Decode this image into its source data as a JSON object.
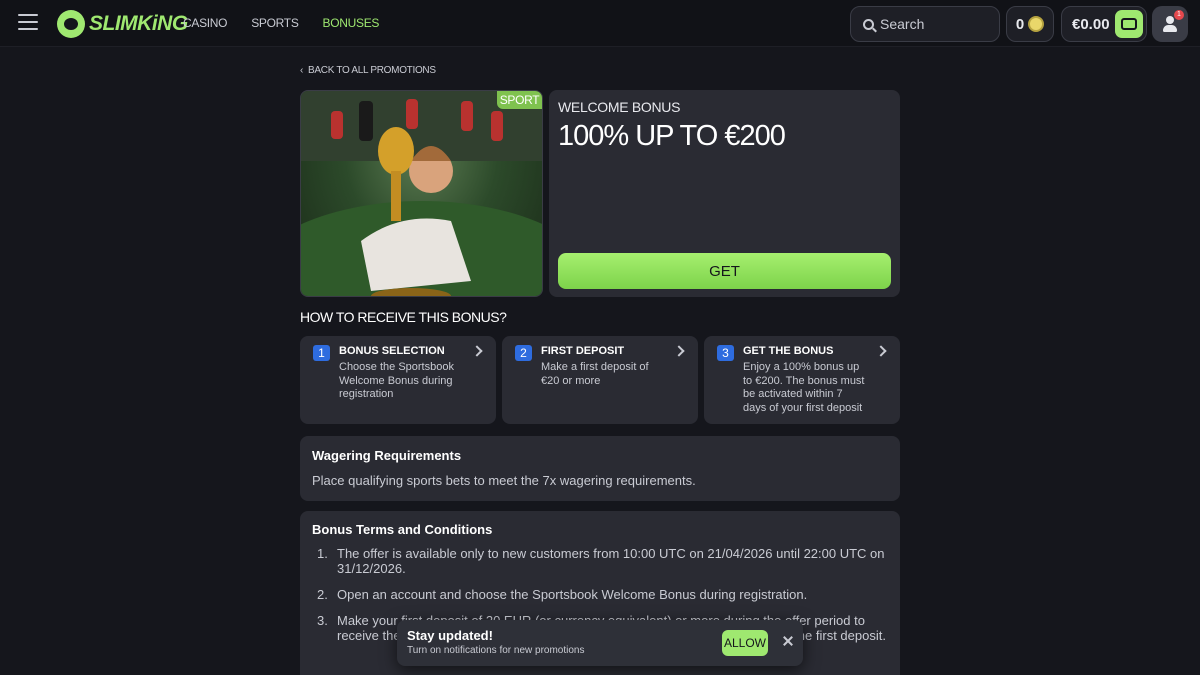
{
  "header": {
    "logo_text": "SLIMKiNG",
    "nav": [
      "CASINO",
      "SPORTS",
      "BONUSES"
    ],
    "search_placeholder": "Search",
    "coins": "0",
    "balance": "€0.00",
    "notification_count": "1"
  },
  "back_link": "BACK TO ALL PROMOTIONS",
  "promo": {
    "tag": "SPORT",
    "subtitle": "WELCOME BONUS",
    "title": "100% UP TO €200",
    "cta": "GET"
  },
  "howto_title": "HOW TO RECEIVE THIS BONUS?",
  "steps": [
    {
      "num": "1",
      "title": "BONUS SELECTION",
      "desc": "Choose the Sportsbook Welcome Bonus during registration"
    },
    {
      "num": "2",
      "title": "FIRST DEPOSIT",
      "desc": "Make a first deposit of €20 or more"
    },
    {
      "num": "3",
      "title": "GET THE BONUS",
      "desc": "Enjoy a 100% bonus up to €200. The bonus must be activated within 7 days of your first deposit"
    }
  ],
  "wagering": {
    "title": "Wagering Requirements",
    "text": "Place qualifying sports bets to meet the 7x wagering requirements."
  },
  "terms": {
    "title": "Bonus Terms and Conditions",
    "items": [
      "The offer is available only to new customers from 10:00 UTC on 21/04/2026 until 22:00 UTC on 31/12/2026.",
      "Open an account and choose the Sportsbook Welcome Bonus during registration.",
      "Make your first deposit of 20 EUR (or currency equivalent) or more during the offer period to receive the 100% bonus. The bonus must be activated within seven (7) days of the first deposit."
    ]
  },
  "toast": {
    "title": "Stay updated!",
    "subtitle": "Turn on notifications for new promotions",
    "allow": "ALLOW"
  }
}
